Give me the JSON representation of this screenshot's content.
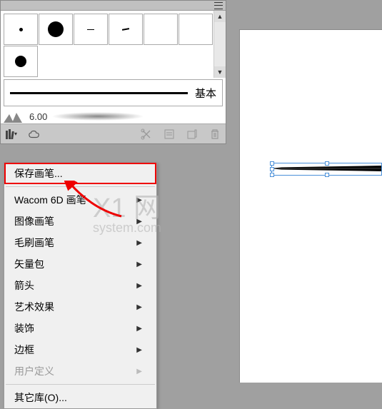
{
  "panel": {
    "stroke_label": "基本",
    "brush_size": "6.00"
  },
  "menu": {
    "save_brush": "保存画笔...",
    "wacom": "Wacom 6D 画笔",
    "image_brush": "图像画笔",
    "bristle_brush": "毛刷画笔",
    "vector_pack": "矢量包",
    "arrows": "箭头",
    "art_effects": "艺术效果",
    "decoration": "装饰",
    "borders": "边框",
    "user_defined": "用户定义",
    "other_libs": "其它库(O)..."
  },
  "watermark": {
    "main": "X1 网",
    "sub": "system.com"
  }
}
